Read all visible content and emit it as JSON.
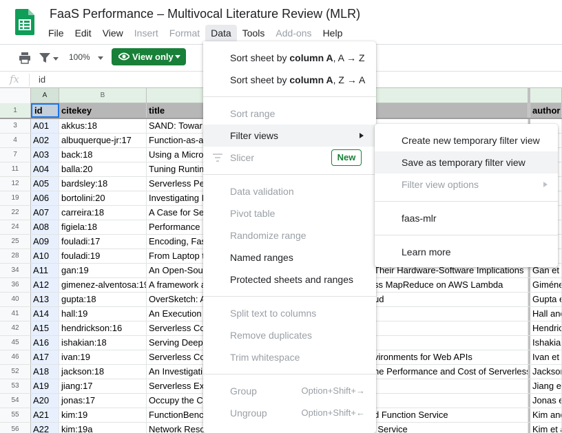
{
  "header": {
    "doc_title": "FaaS Performance – Multivocal Literature Review (MLR)",
    "menus": [
      {
        "label": "File",
        "state": "enabled"
      },
      {
        "label": "Edit",
        "state": "enabled"
      },
      {
        "label": "View",
        "state": "enabled"
      },
      {
        "label": "Insert",
        "state": "disabled"
      },
      {
        "label": "Format",
        "state": "disabled"
      },
      {
        "label": "Data",
        "state": "active"
      },
      {
        "label": "Tools",
        "state": "enabled"
      },
      {
        "label": "Add-ons",
        "state": "disabled"
      },
      {
        "label": "Help",
        "state": "enabled"
      }
    ]
  },
  "toolbar": {
    "zoom": "100%",
    "view_only_label": "View only",
    "accent_color": "#188038",
    "icons": [
      "print-icon",
      "filter-icon",
      "eye-icon"
    ]
  },
  "formula_bar": {
    "fx": "fx",
    "value": "id"
  },
  "grid": {
    "columns": [
      "A",
      "B",
      "",
      ""
    ],
    "header_row": {
      "num": "1",
      "a": "id",
      "b": "citekey",
      "c": "title",
      "d": "author"
    },
    "rows": [
      {
        "num": "3",
        "a": "A01",
        "b": "akkus:18",
        "c": "SAND: Towar",
        "d": ""
      },
      {
        "num": "4",
        "a": "A02",
        "b": "albuquerque-jr:17",
        "c": "Function-as-a",
        "d": ""
      },
      {
        "num": "7",
        "a": "A03",
        "b": "back:18",
        "c": "Using a Micro",
        "d": ""
      },
      {
        "num": "11",
        "a": "A04",
        "b": "balla:20",
        "c": "Tuning Runtim",
        "d": ""
      },
      {
        "num": "12",
        "a": "A05",
        "b": "bardsley:18",
        "c": "Serverless Pe",
        "d": ""
      },
      {
        "num": "19",
        "a": "A06",
        "b": "bortolini:20",
        "c": "Investigating I",
        "d": ""
      },
      {
        "num": "22",
        "a": "A07",
        "b": "carreira:18",
        "c": "A Case for Se",
        "d": ""
      },
      {
        "num": "24",
        "a": "A08",
        "b": "figiela:18",
        "c": "Performance",
        "d": ""
      },
      {
        "num": "25",
        "a": "A09",
        "b": "fouladi:17",
        "c": "Encoding, Fas",
        "d": ""
      },
      {
        "num": "28",
        "a": "A10",
        "b": "fouladi:19",
        "c": "From Laptop t",
        "d": ""
      },
      {
        "num": "34",
        "a": "A11",
        "b": "gan:19",
        "c": "An Open-Sour",
        "c_tail": "Their Hardware-Software Implications",
        "d": "Gan et a"
      },
      {
        "num": "36",
        "a": "A12",
        "b": "gimenez-alventosa:19",
        "c": "A framework a",
        "c_tail": "ss MapReduce on AWS Lambda",
        "d": "Giménez"
      },
      {
        "num": "40",
        "a": "A13",
        "b": "gupta:18",
        "c": "OverSketch: A",
        "c_tail": "ud",
        "d": "Gupta et"
      },
      {
        "num": "41",
        "a": "A14",
        "b": "hall:19",
        "c": "An Execution",
        "c_tail": "",
        "d": "Hall and"
      },
      {
        "num": "42",
        "a": "A15",
        "b": "hendrickson:16",
        "c": "Serverless Co",
        "c_tail": "",
        "d": "Hendrick"
      },
      {
        "num": "45",
        "a": "A16",
        "b": "ishakian:18",
        "c": "Serving Deep",
        "c_tail": "",
        "d": "Ishakian"
      },
      {
        "num": "46",
        "a": "A17",
        "b": "ivan:19",
        "c": "Serverless Co",
        "c_tail": "vironments for Web APIs",
        "d": "Ivan et a"
      },
      {
        "num": "52",
        "a": "A18",
        "b": "jackson:18",
        "c": "An Investigati",
        "c_tail": "ne Performance and Cost of Serverless",
        "d": "Jackson"
      },
      {
        "num": "53",
        "a": "A19",
        "b": "jiang:17",
        "c": "Serverless Ex",
        "c_tail": "",
        "d": "Jiang et"
      },
      {
        "num": "54",
        "a": "A20",
        "b": "jonas:17",
        "c": "Occupy the C",
        "c_tail": "",
        "d": "Jonas et"
      },
      {
        "num": "55",
        "a": "A21",
        "b": "kim:19",
        "c": "FunctionBenc",
        "c_tail": "d Function Service",
        "d": "Kim and"
      },
      {
        "num": "56",
        "a": "A22",
        "b": "kim:19a",
        "c": "Network Resource Isolation in Serverless Cloud Function Service",
        "c_tail": "",
        "d": "Kim et a"
      }
    ]
  },
  "data_menu": {
    "sort_az": {
      "prefix": "Sort sheet by ",
      "bold": "column A",
      "suffix": ", A → Z"
    },
    "sort_za": {
      "prefix": "Sort sheet by ",
      "bold": "column A",
      "suffix": ", Z → A"
    },
    "sort_range": "Sort range",
    "filter_views": "Filter views",
    "slicer": "Slicer",
    "new_badge": "New",
    "data_validation": "Data validation",
    "pivot_table": "Pivot table",
    "randomize_range": "Randomize range",
    "named_ranges": "Named ranges",
    "protected": "Protected sheets and ranges",
    "split_text": "Split text to columns",
    "remove_duplicates": "Remove duplicates",
    "trim_whitespace": "Trim whitespace",
    "group": "Group",
    "group_shortcut": "Option+Shift+→",
    "ungroup": "Ungroup",
    "ungroup_shortcut": "Option+Shift+←"
  },
  "filter_views_submenu": {
    "create_temp": "Create new temporary filter view",
    "save_temp": "Save as temporary filter view",
    "options": "Filter view options",
    "saved_view": "faas-mlr",
    "learn_more": "Learn more"
  }
}
